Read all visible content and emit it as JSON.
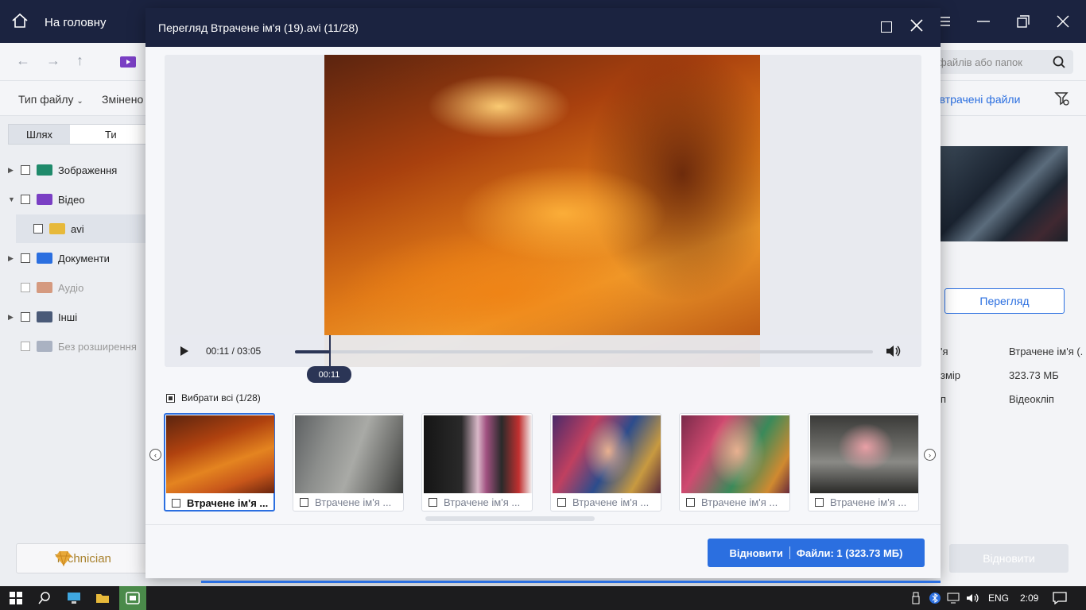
{
  "app": {
    "home_label": "На головну",
    "search_placeholder": "файлів або папок",
    "filter_type_label": "Тип файлу",
    "filter_changed_label": "Змінено",
    "filter_right_label": "е втрачені файли",
    "tab_path": "Шлях",
    "tab_type": "Ти",
    "tree": [
      {
        "label": "Зображення",
        "expandable": true,
        "color": "#1f8a6b"
      },
      {
        "label": "Відео",
        "expandable": true,
        "expanded": true,
        "color": "#7a3fc4"
      },
      {
        "label": "avi",
        "child": true,
        "color": "#e7b93a"
      },
      {
        "label": "Документи",
        "expandable": true,
        "color": "#2b6fe0"
      },
      {
        "label": "Аудіо",
        "dim": true,
        "color": "#d59a80"
      },
      {
        "label": "Інші",
        "expandable": true,
        "color": "#4a5a78"
      },
      {
        "label": "Без розширення",
        "dim": true,
        "color": "#aab2c2"
      }
    ],
    "technician_label": "Technician",
    "preview_button": "Перегляд",
    "info": [
      {
        "key": "'я",
        "value": "Втрачене ім'я (."
      },
      {
        "key": "змір",
        "value": "323.73 МБ"
      },
      {
        "key": "п",
        "value": "Відеокліп"
      }
    ],
    "recover_disabled": "Відновити"
  },
  "modal": {
    "title": "Перегляд Втрачене ім'я (19).avi (11/28)",
    "time_display": "00:11 / 03:05",
    "tooltip_time": "00:11",
    "progress_fraction": 0.06,
    "select_all": "Вибрати всі (1/28)",
    "thumbnails": [
      {
        "caption": "Втрачене ім'я ...",
        "active": true,
        "img": "linear-gradient(160deg,#5b240f 0%,#b0420f 35%,#e48420 60%,#c8561a 80%,#6a250e 100%)"
      },
      {
        "caption": "Втрачене ім'я ...",
        "img": "linear-gradient(110deg,#5d6062 0%,#8c8e8c 30%,#a9aaa6 55%,#6f706d 80%,#3b3c3a 100%)"
      },
      {
        "caption": "Втрачене ім'я ...",
        "img": "linear-gradient(90deg,#151515 0%,#2a2a2a 35%,#d9b8c8 50%,#a05080 58%,#2a2a2a 72%,#c23030 88%,#f2f2f2 100%)"
      },
      {
        "caption": "Втрачене ім'я ...",
        "img": "radial-gradient(ellipse 30px 40px at 70px 45px,#e8b090,transparent),linear-gradient(120deg,#4a2a6a 0%,#c04060 30%,#2c4c8c 55%,#c89a40 80%,#5a2a3a 100%)"
      },
      {
        "caption": "Втрачене ім'я ...",
        "img": "radial-gradient(ellipse 35px 45px at 70px 45px,#e8b090,transparent),linear-gradient(120deg,#7a2a4a 0%,#d04a70 30%,#3a8a5a 60%,#d08a30 85%,#6a2a3a 100%)"
      },
      {
        "caption": "Втрачене ім'я ...",
        "img": "radial-gradient(ellipse 35px 30px at 70px 40px,#e9a0a6,transparent),linear-gradient(180deg,#3a3a38 0%,#6a6a66 40%,#8a8a86 60%,#2a2a28 100%)"
      }
    ],
    "recover_label": "Відновити",
    "files_label": "Файли: 1 (323.73 МБ)"
  },
  "taskbar": {
    "lang": "ENG",
    "clock": "2:09"
  },
  "colors": {
    "dark_header": "#1b2340",
    "accent": "#2b6fe0"
  }
}
